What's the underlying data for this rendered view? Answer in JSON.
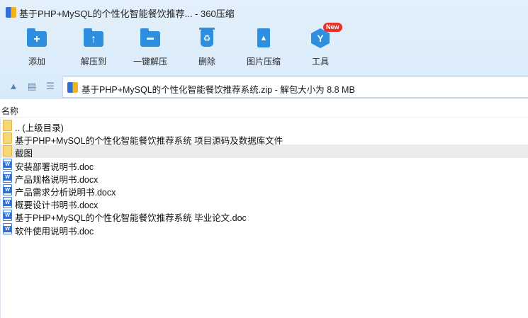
{
  "window": {
    "title": "基于PHP+MySQL的个性化智能餐饮推荐... - 360压缩",
    "app_icon": "360-zip-icon"
  },
  "toolbar": {
    "buttons": [
      {
        "label": "添加",
        "icon": "add-folder-icon",
        "glyph": "+"
      },
      {
        "label": "解压到",
        "icon": "extract-to-icon",
        "glyph": "↑"
      },
      {
        "label": "一键解压",
        "icon": "one-click-extract-icon",
        "glyph": "━"
      },
      {
        "label": "删除",
        "icon": "delete-bin-icon",
        "glyph": "♻"
      },
      {
        "label": "图片压缩",
        "icon": "image-compress-icon",
        "glyph": "▲"
      },
      {
        "label": "工具",
        "icon": "tools-icon",
        "glyph": "Y",
        "badge": "New"
      }
    ]
  },
  "address": {
    "path": "基于PHP+MySQL的个性化智能餐饮推荐系统.zip - 解包大小为 8.8 MB"
  },
  "list": {
    "column_name": "名称",
    "items": [
      {
        "name": ".. (上级目录)",
        "type": "folder"
      },
      {
        "name": "基于PHP+MySQL的个性化智能餐饮推荐系统 项目源码及数据库文件",
        "type": "folder"
      },
      {
        "name": "截图",
        "type": "folder",
        "selected": true
      },
      {
        "name": "安装部署说明书.doc",
        "type": "doc"
      },
      {
        "name": "产品规格说明书.docx",
        "type": "doc"
      },
      {
        "name": "产品需求分析说明书.docx",
        "type": "doc"
      },
      {
        "name": "概要设计书明书.docx",
        "type": "doc"
      },
      {
        "name": "基于PHP+MySQL的个性化智能餐饮推荐系统 毕业论文.doc",
        "type": "doc"
      },
      {
        "name": "软件使用说明书.doc",
        "type": "doc"
      }
    ]
  },
  "colors": {
    "accent": "#2e8fe0",
    "toolbar_bg": "#dceefb",
    "selected_row": "#ebebeb",
    "badge": "#e5332a"
  }
}
